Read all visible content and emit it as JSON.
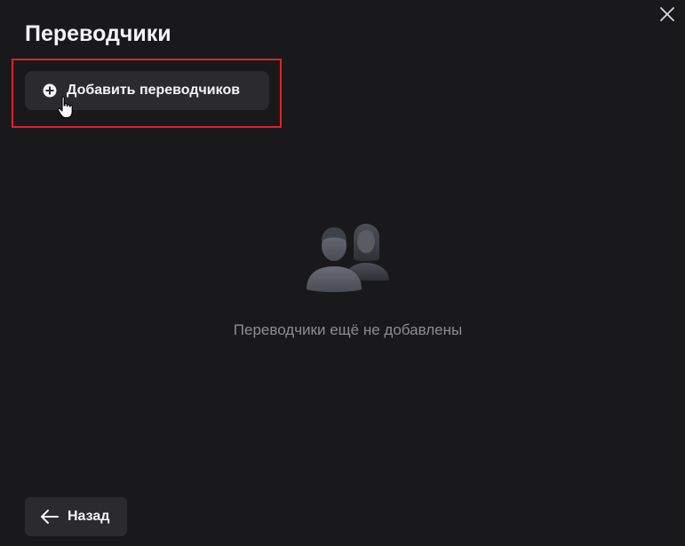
{
  "dialog": {
    "title": "Переводчики",
    "close_icon": "close-icon"
  },
  "toolbar": {
    "add_label": "Добавить переводчиков",
    "add_icon": "plus-circle-icon",
    "highlight_color": "#e0202a"
  },
  "empty_state": {
    "illustration_icon": "users-icon",
    "message": "Переводчики ещё не добавлены"
  },
  "footer": {
    "back_label": "Назад",
    "back_icon": "arrow-left-icon"
  },
  "colors": {
    "background": "#19191b",
    "button_bg": "#2b2b2e",
    "muted_text": "#8c8c94"
  }
}
